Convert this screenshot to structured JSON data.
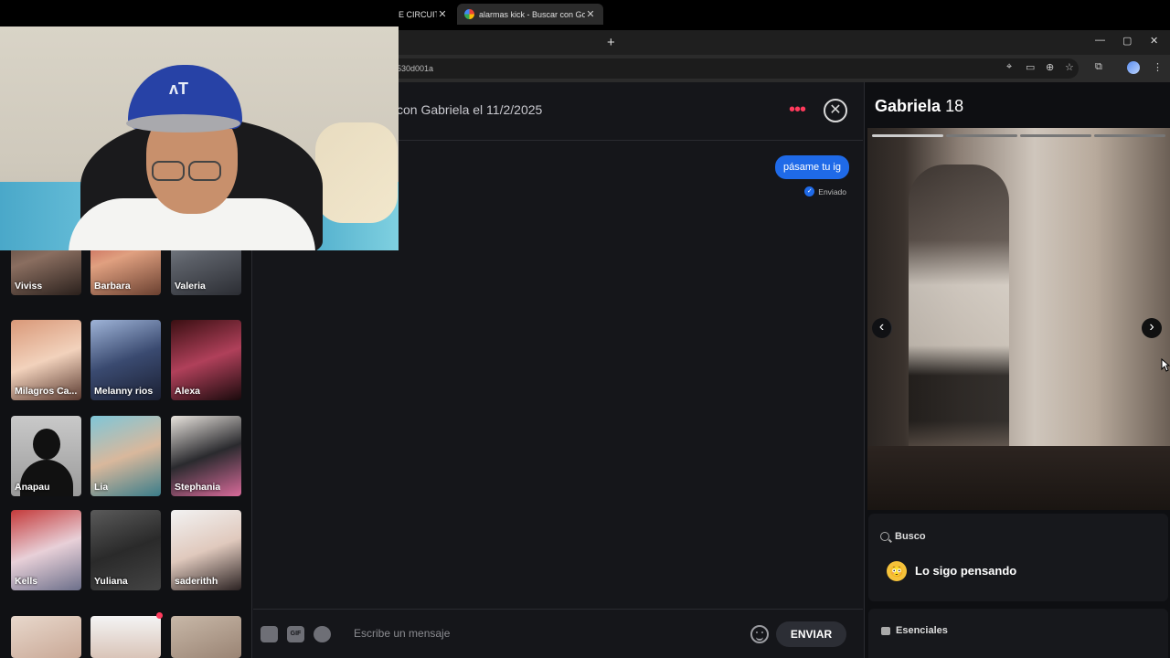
{
  "browser": {
    "tabs": [
      {
        "label": "E CIRCUIT"
      },
      {
        "label": "alarmas kick - Buscar con Goog"
      }
    ],
    "tab_close": "✕",
    "new_tab": "+",
    "address": "530d001a",
    "window_controls": {
      "minimize": "—",
      "restore": "▢",
      "close": "✕"
    }
  },
  "sidebar": {
    "profiles": [
      {
        "name": "Viviss"
      },
      {
        "name": "Barbara"
      },
      {
        "name": "Valeria"
      },
      {
        "name": "Milagros Ca..."
      },
      {
        "name": "Melanny rios"
      },
      {
        "name": "Alexa"
      },
      {
        "name": "Anapau"
      },
      {
        "name": "Lia"
      },
      {
        "name": "Stephania"
      },
      {
        "name": "Kells"
      },
      {
        "name": "Yuliana"
      },
      {
        "name": "saderithh"
      }
    ]
  },
  "chat": {
    "header_title": "con Gabriela el 11/2/2025",
    "menu": "•••",
    "close": "✕",
    "messages": [
      {
        "text": "pásame tu ig",
        "status": "Enviado"
      }
    ],
    "composer": {
      "gif_label": "GIF",
      "placeholder": "Escribe un mensaje",
      "send_label": "ENVIAR"
    }
  },
  "profile": {
    "name": "Gabriela",
    "age": "18",
    "prev": "‹",
    "next": "›",
    "busco_label": "Busco",
    "busco_value": "Lo sigo pensando",
    "busco_emoji": "😳",
    "esenciales_label": "Esenciales"
  }
}
